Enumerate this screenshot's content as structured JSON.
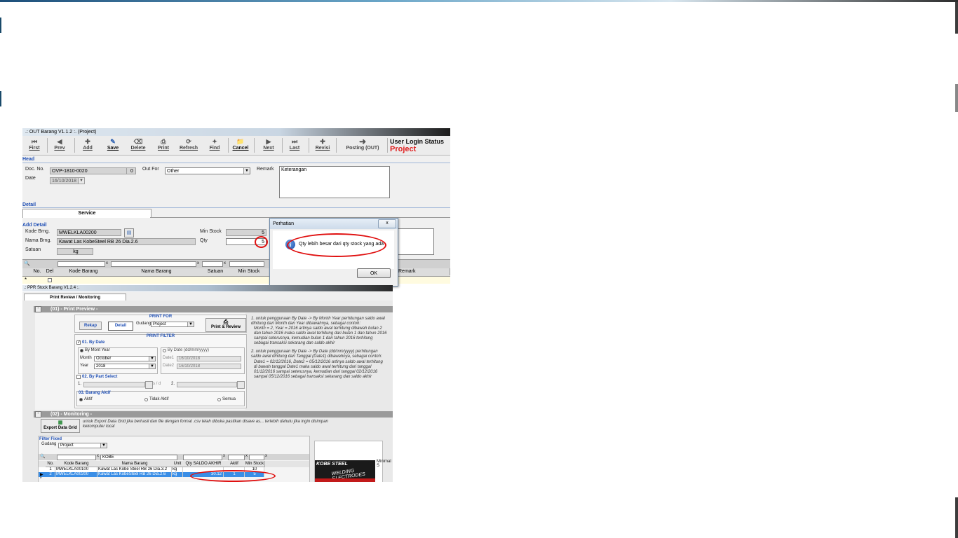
{
  "colors": {
    "accent": "#1f4fb5",
    "alert_ring": "#e01010",
    "selected_row": "#3a8ee6",
    "project": "#e02020"
  },
  "win1": {
    "title": ".: OUT Barang V1.1.2 :. (Project)",
    "toolbar": {
      "first": "First",
      "prev": "Prev",
      "add": "Add",
      "save": "Save",
      "delete": "Delete",
      "print": "Print",
      "refresh": "Refresh",
      "find": "Find",
      "cancel": "Cancel",
      "next": "Next",
      "last": "Last",
      "revisi": "Revisi",
      "posting": "Posting (OUT)"
    },
    "user_status_label": "User Login Status",
    "user_status_value": "Project",
    "head": {
      "section": "Head",
      "doc_no_label": "Doc. No.",
      "doc_no": "OVP-1810-0020",
      "doc_no_count": "0",
      "out_for_label": "Out For",
      "out_for": "Other",
      "remark_label": "Remark",
      "remark": "Keterangan",
      "date_label": "Date",
      "date": "16/10/2018"
    },
    "detail": {
      "section": "Detail",
      "tab_service": "Service"
    },
    "add_detail": {
      "section": "Add Detail",
      "kode_label": "Kode Brng.",
      "kode": "MWELKLA00200",
      "nama_label": "Nama Brng.",
      "nama": "Kawat Las KobeSteel RB 26 Dia.2.6",
      "satuan_label": "Satuan",
      "satuan": "kg",
      "min_stock_label": "Min Stock",
      "min_stock": "5",
      "qty_label": "Qty",
      "qty": "5"
    },
    "grid": {
      "headers": [
        "No.",
        "Del",
        "Kode Barang",
        "Nama Barang",
        "Satuan",
        "Min Stock",
        "Remark"
      ],
      "new_row": "*"
    }
  },
  "dialog": {
    "title": "Perhatian",
    "message": "Qty lebih besar dari qty stock yang ada",
    "ok": "OK",
    "close": "x"
  },
  "win2": {
    "title": ".: PPR Stock Barang V1.2.4 :.",
    "tab": "Print Review / Monitoring",
    "section1": "(01) - Print Preview -",
    "print_for": "PRINT FOR",
    "rekap": "Rekap",
    "detail": "Detail",
    "gudang_label": "Gudang",
    "gudang": "Project",
    "print_review": "Print & Review",
    "print_filter": "PRINT FILTER",
    "by_date_label": "01. By Date",
    "by_mont_year": "By Mont Year",
    "by_date_range": "By Date (dd/mm/yyyy)",
    "month_label": "Month",
    "month": "October",
    "year_label": "Year",
    "year": "2018",
    "date1_label": "Date1",
    "date1": "16/10/2018",
    "date2_label": "Date2",
    "date2": "16/10/2018",
    "by_part_label": "02. By Part Select",
    "part1_label": "1.",
    "part2_label": "2.",
    "part_sep": "s / d",
    "aktif_group": "03. Barang Aktif",
    "aktif": "Aktif",
    "tidak_aktif": "Tidak Aktif",
    "semua": "Semua",
    "notes": [
      "1. untuk penggunaan By Date -> By Month Year perhitungan saldo awal dihitung dari Month dan Year dibawahnya, sebagai contoh:",
      "Month = 2, Year = 2016 artinya saldo awal terhitung dibawah bulan 2 dan tahun 2016 maka saldo awal terhitung dari bulan 1 dan tahun 2016 sampai seterusnya, kemudian bulan 1 dan tahun 2016 terhitung sebagai transaksi sekarang dan saldo akhir",
      "2. untuk penggunaan By Date -> By Date (dd/mm/yyyy) perhitungan saldo awal dihitung dari Tanggal (Date1) dibawahnya, sebagai contoh:",
      "Date1 = 02/12/2016, Date2 = 05/12/2016 artinya saldo awal terhitung di bawah tanggal Date1 maka saldo awal terhitung dari tanggal 01/12/2016 sampai seterusnya, kemudian dari tanggal 02/12/2016 sampai 05/12/2016 sebagai transaksi sekarang dan saldo akhir"
    ],
    "section2": "(02) - Monitoring -",
    "export_btn": "Export Data Grid",
    "export_note": "untuk Export Data Grid jika berhasil dan file dengan format .csv telah dibuka pastikan disave as... terlebih dahulu jika ingin disimpan kekomputer local",
    "filter_fixed": "Filter Fixed",
    "filter_gudang_label": "Gudang",
    "filter_gudang": "Project",
    "search_nama": "KOBE",
    "grid_headers": [
      "No.",
      "Kode Barang",
      "Nama Barang",
      "Unit",
      "Qty SALDO AKHIR",
      "Aktif",
      "Min Stock"
    ],
    "rows": [
      {
        "no": "1",
        "kode": "MWELKLA00100",
        "nama": "Kawat Las Kobe Steel RB 26 Dia.3.2",
        "unit": "kg",
        "qty": "",
        "aktif": "",
        "min": "10"
      },
      {
        "no": "2",
        "kode": "MWELKLA00200",
        "nama": "Kawat Las KobeSteel RB 26 Dia.2.6",
        "unit": "kg",
        "qty": "30.12",
        "aktif": "1",
        "min": "5"
      }
    ],
    "minimal_label": "Minimal S",
    "kobe_logo": "KOBE STEEL",
    "kobe_sub": "WELDING ELECTRODES"
  }
}
